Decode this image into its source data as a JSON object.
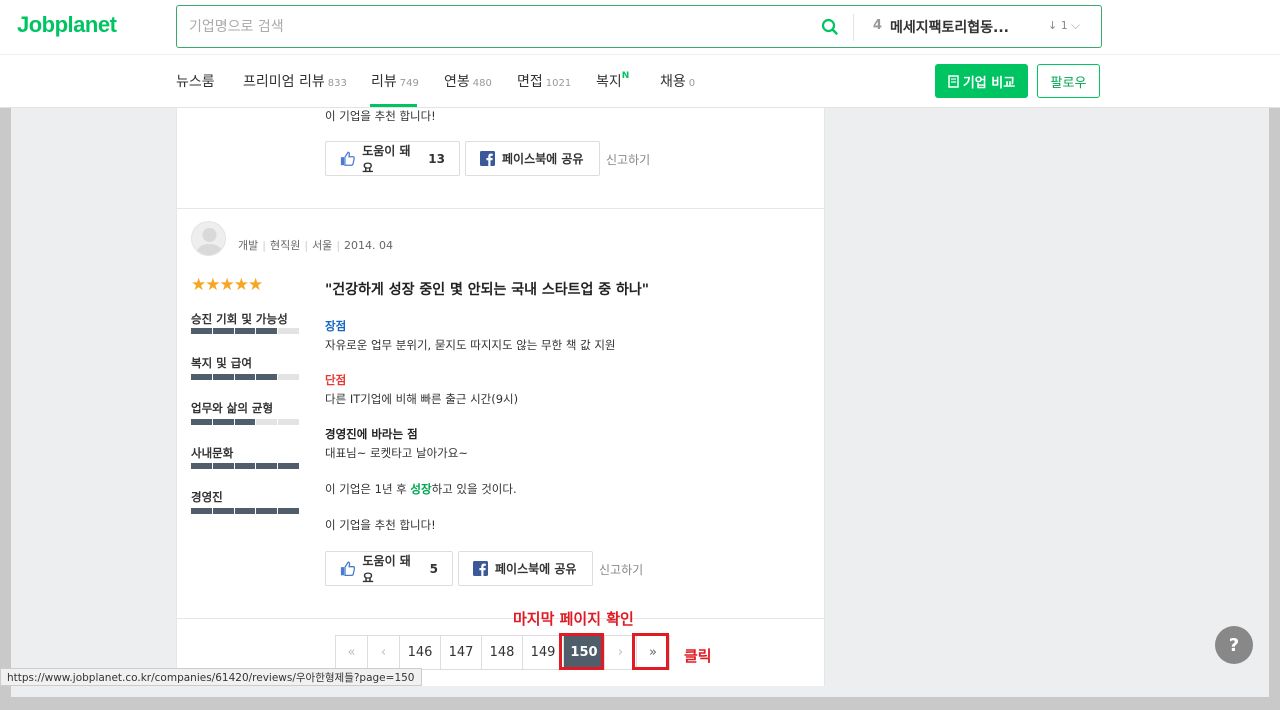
{
  "header": {
    "logo": "Jobplanet",
    "search_placeholder": "기업명으로 검색",
    "rank_number": "4",
    "rank_company": "메세지팩토리협동...",
    "rank_change": "↓ 1"
  },
  "nav": {
    "items": [
      {
        "label": "뉴스룸",
        "count": ""
      },
      {
        "label": "프리미엄 리뷰",
        "count": "833"
      },
      {
        "label": "리뷰",
        "count": "749"
      },
      {
        "label": "연봉",
        "count": "480"
      },
      {
        "label": "면접",
        "count": "1021"
      },
      {
        "label": "복지",
        "count": "",
        "badge": "N"
      },
      {
        "label": "채용",
        "count": "0"
      }
    ],
    "compare_button": "기업 비교",
    "follow_button": "팔로우"
  },
  "prev_review": {
    "recommend_text": "이 기업을 추천 합니다!",
    "helpful_label": "도움이 돼요",
    "helpful_count": "13",
    "share_label": "페이스북에 공유",
    "report_label": "신고하기"
  },
  "review": {
    "meta": {
      "job": "개발",
      "status": "현직원",
      "location": "서울",
      "date": "2014. 04"
    },
    "stars": "★★★★★",
    "rating": 5,
    "categories": [
      {
        "label": "승진 기회 및 가능성",
        "score": 4
      },
      {
        "label": "복지 및 급여",
        "score": 4
      },
      {
        "label": "업무와 삶의 균형",
        "score": 3
      },
      {
        "label": "사내문화",
        "score": 5
      },
      {
        "label": "경영진",
        "score": 5
      }
    ],
    "title": "\"건강하게 성장 중인 몇 안되는 국내 스타트업 중 하나\"",
    "pros_label": "장점",
    "pros_text": "자유로운 업무 분위기, 묻지도 따지지도 않는 무한 책 값 지원",
    "cons_label": "단점",
    "cons_text": "다른 IT기업에 비해 빠른 출근 시간(9시)",
    "advice_label": "경영진에 바라는 점",
    "advice_text": "대표님~ 로켓타고 날아가요~",
    "outlook_prefix": "이 기업은 1년 후 ",
    "outlook_word": "성장",
    "outlook_suffix": "하고 있을 것이다.",
    "recommend_text": "이 기업을 추천 합니다!",
    "helpful_label": "도움이 돼요",
    "helpful_count": "5",
    "share_label": "페이스북에 공유",
    "report_label": "신고하기"
  },
  "pagination": {
    "first": "«",
    "prev": "‹",
    "pages": [
      "146",
      "147",
      "148",
      "149"
    ],
    "current": "150",
    "next": "›",
    "last": "»"
  },
  "annotations": {
    "last_page_check": "마지막 페이지 확인",
    "click": "클릭"
  },
  "help_button": "?",
  "status_url": "https://www.jobplanet.co.kr/companies/61420/reviews/우아한형제들?page=150",
  "colors": {
    "brand_green": "#00c362",
    "bar_fill": "#4f5e6a",
    "pros_blue": "#1565c0",
    "cons_red": "#e53935",
    "annotation_red": "#e01b24"
  }
}
